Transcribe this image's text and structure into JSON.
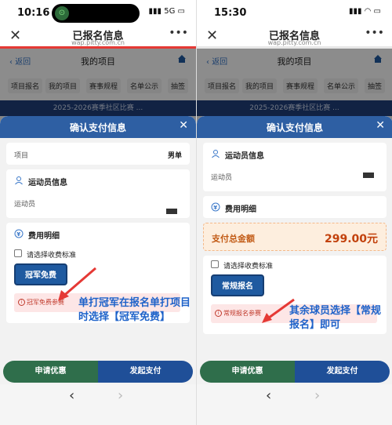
{
  "left": {
    "status": {
      "time": "10:16",
      "signal": "5G"
    },
    "browser": {
      "title": "已报名信息",
      "url": "wap.pitty.com.cn"
    },
    "page": {
      "back": "返回",
      "title": "我的项目"
    },
    "tabs": [
      "项目报名",
      "我的项目",
      "赛事规程",
      "名单公示",
      "抽签"
    ],
    "banner": "2025-2026赛季社区比赛 ...",
    "sheet": {
      "title": "确认支付信息",
      "project_label": "项目",
      "project_value": "男单",
      "athlete_section": "运动员信息",
      "athlete_label": "运动员",
      "fee_section": "费用明细",
      "choose_label": "请选择收费标准",
      "fee_button": "冠军免费",
      "note": "冠军免费参赛"
    },
    "annotation": "单打冠军在报名单打项目时选择【冠军免费】",
    "bottom": {
      "discount": "申请优惠",
      "pay": "发起支付"
    }
  },
  "right": {
    "status": {
      "time": "15:30"
    },
    "browser": {
      "title": "已报名信息",
      "url": "wap.pitty.com.cn"
    },
    "page": {
      "back": "返回",
      "title": "我的项目"
    },
    "tabs": [
      "项目报名",
      "我的项目",
      "赛事规程",
      "名单公示",
      "抽签"
    ],
    "banner": "2025-2026赛季社区比赛 ...",
    "sheet": {
      "title": "确认支付信息",
      "athlete_section": "运动员信息",
      "athlete_label": "运动员",
      "fee_section": "费用明细",
      "total_label": "支付总金额",
      "total_value": "299.00元",
      "choose_label": "请选择收费标准",
      "fee_button": "常规报名",
      "note": "常规报名参赛"
    },
    "annotation": "其余球员选择【常规报名】即可",
    "bottom": {
      "discount": "申请优惠",
      "pay": "发起支付"
    }
  }
}
